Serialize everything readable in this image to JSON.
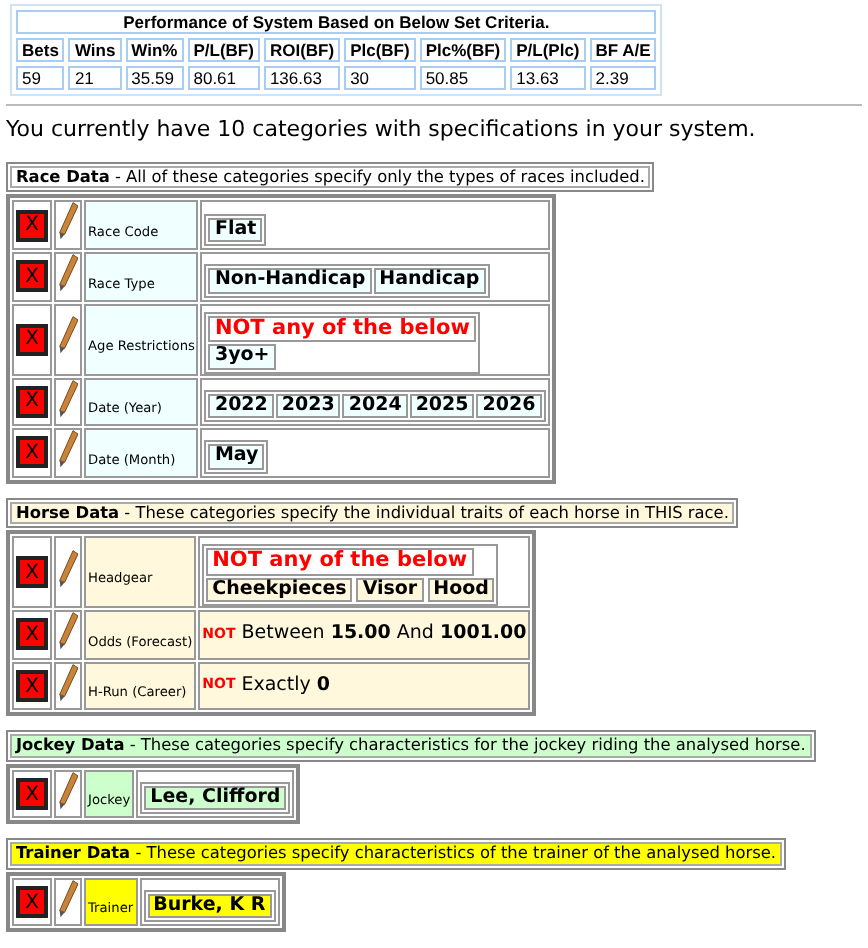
{
  "performance": {
    "title": "Performance of System Based on Below Set Criteria.",
    "columns": [
      "Bets",
      "Wins",
      "Win%",
      "P/L(BF)",
      "ROI(BF)",
      "Plc(BF)",
      "Plc%(BF)",
      "P/L(Plc)",
      "BF A/E"
    ],
    "values": [
      "59",
      "21",
      "35.59",
      "80.61",
      "136.63",
      "30",
      "50.85",
      "13.63",
      "2.39"
    ]
  },
  "summary": "You currently have 10 categories with specifications in your system.",
  "sections": [
    {
      "title": "Race Data",
      "description": "- All of these categories specify only the types of races included.",
      "color": "#f0ffff",
      "rows": [
        {
          "delete": "X",
          "label": "Race Code",
          "kind": "values",
          "values": [
            "Flat"
          ]
        },
        {
          "delete": "X",
          "label": "Race Type",
          "kind": "values",
          "values": [
            "Non-Handicap",
            "Handicap"
          ]
        },
        {
          "delete": "X",
          "label": "Age Restrictions",
          "kind": "values",
          "not_header": "NOT any of the below",
          "values": [
            "3yo+"
          ]
        },
        {
          "delete": "X",
          "label": "Date (Year)",
          "kind": "values",
          "values": [
            "2022",
            "2023",
            "2024",
            "2025",
            "2026"
          ]
        },
        {
          "delete": "X",
          "label": "Date (Month)",
          "kind": "values",
          "values": [
            "May"
          ]
        }
      ]
    },
    {
      "title": "Horse Data",
      "description": "- These categories specify the individual traits of each horse in THIS race.",
      "color": "#fff8dc",
      "rows": [
        {
          "delete": "X",
          "label": "Headgear",
          "kind": "values",
          "not_header": "NOT any of the below",
          "values": [
            "Cheekpieces",
            "Visor",
            "Hood"
          ]
        },
        {
          "delete": "X",
          "label": "Odds (Forecast)",
          "kind": "range",
          "not": "NOT",
          "text": "Between **15.00** And **1001.00**"
        },
        {
          "delete": "X",
          "label": "H-Run (Career)",
          "kind": "range",
          "not": "NOT",
          "text": "Exactly **0**"
        }
      ]
    },
    {
      "title": "Jockey Data",
      "description": "- These categories specify characteristics for the jockey riding the analysed horse.",
      "color": "#ccffcc",
      "rows": [
        {
          "delete": "X",
          "label": "Jockey",
          "kind": "values",
          "values": [
            "Lee, Clifford"
          ]
        }
      ]
    },
    {
      "title": "Trainer Data",
      "description": "- These categories specify characteristics of the trainer of the analysed horse.",
      "color": "#ffff00",
      "rows": [
        {
          "delete": "X",
          "label": "Trainer",
          "kind": "values",
          "values": [
            "Burke, K R"
          ]
        }
      ]
    }
  ]
}
